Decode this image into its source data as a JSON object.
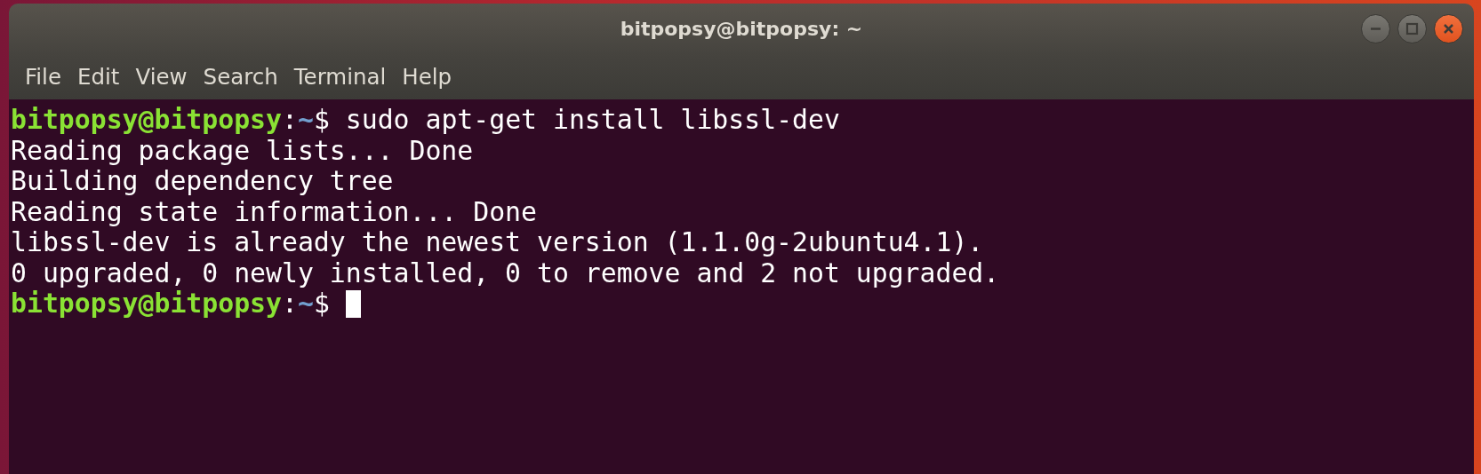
{
  "window": {
    "title": "bitpopsy@bitpopsy: ~",
    "controls": [
      {
        "kind": "minimize"
      },
      {
        "kind": "maximize"
      },
      {
        "kind": "close"
      }
    ]
  },
  "menu": [
    "File",
    "Edit",
    "View",
    "Search",
    "Terminal",
    "Help"
  ],
  "terminal": {
    "lines": [
      {
        "kind": "prompt",
        "user_host": "bitpopsy@bitpopsy",
        "separator": ":",
        "path": "~",
        "symbol": "$",
        "command": "sudo apt-get install libssl-dev"
      },
      {
        "kind": "output",
        "text": "Reading package lists... Done"
      },
      {
        "kind": "output",
        "text": "Building dependency tree"
      },
      {
        "kind": "output",
        "text": "Reading state information... Done"
      },
      {
        "kind": "output",
        "text": "libssl-dev is already the newest version (1.1.0g-2ubuntu4.1)."
      },
      {
        "kind": "output",
        "text": "0 upgraded, 0 newly installed, 0 to remove and 2 not upgraded."
      },
      {
        "kind": "prompt",
        "user_host": "bitpopsy@bitpopsy",
        "separator": ":",
        "path": "~",
        "symbol": "$",
        "cursor": true
      }
    ]
  }
}
